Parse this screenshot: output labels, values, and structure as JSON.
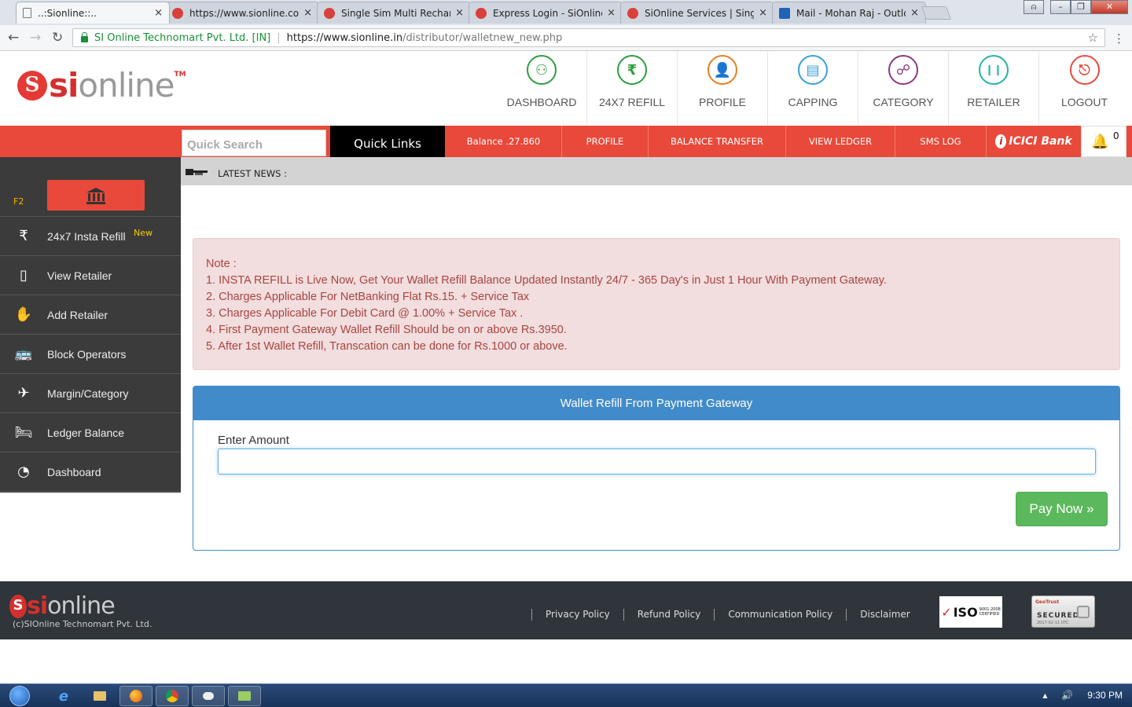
{
  "browser": {
    "tabs": [
      {
        "title": "..:Sionline::..",
        "active": true,
        "favicon": "doc-icon"
      },
      {
        "title": "https://www.sionline.co.in",
        "favicon": "sionline-icon"
      },
      {
        "title": "Single Sim Multi Recharge",
        "favicon": "sionline-icon"
      },
      {
        "title": "Express Login - SiOnline",
        "favicon": "sionline-icon"
      },
      {
        "title": "SiOnline Services | Single",
        "favicon": "sionline-icon"
      },
      {
        "title": "Mail - Mohan Raj - Outlook",
        "favicon": "outlook-icon"
      }
    ],
    "close_glyph": "×",
    "secure_label": "SI Online Technomart Pvt. Ltd. [IN]",
    "url_host": "https://www.sionline.in",
    "url_path": "/distributor/walletnew_new.php"
  },
  "header": {
    "logo": {
      "mark": "S",
      "si": "si",
      "online": "online",
      "tm": "TM"
    },
    "nav": [
      {
        "label": "DASHBOARD",
        "color": "#2e9e3e",
        "glyph": "⚇"
      },
      {
        "label": "24X7 REFILL",
        "color": "#2e9e3e",
        "glyph": "₹"
      },
      {
        "label": "PROFILE",
        "color": "#e67e22",
        "glyph": "👤"
      },
      {
        "label": "CAPPING",
        "color": "#3aa0d8",
        "glyph": "▤"
      },
      {
        "label": "CATEGORY",
        "color": "#8e3a7c",
        "glyph": "☍"
      },
      {
        "label": "RETAILER",
        "color": "#26b5a6",
        "glyph": "❙❙"
      },
      {
        "label": "LOGOUT",
        "color": "#e74c3c",
        "glyph": "⎋"
      }
    ]
  },
  "redbar": {
    "search_placeholder": "Quick Search",
    "quick_links": "Quick Links",
    "links": [
      "Balance .27.860",
      "PROFILE",
      "BALANCE TRANSFER",
      "VIEW LEDGER",
      "SMS LOG"
    ],
    "bank": "ICICI Bank",
    "bank_glyph": "i",
    "notification_count": "0"
  },
  "sidebar": {
    "f2": "F2",
    "items": [
      {
        "label": "24x7 Insta Refill",
        "badge": "New",
        "icon": "rupee-icon",
        "glyph": "₹"
      },
      {
        "label": "View Retailer",
        "icon": "mobile-icon",
        "glyph": "▯"
      },
      {
        "label": "Add Retailer",
        "icon": "hand-money-icon",
        "glyph": "✋"
      },
      {
        "label": "Block Operators",
        "icon": "bus-icon",
        "glyph": "🚌"
      },
      {
        "label": "Margin/Category",
        "icon": "plane-icon",
        "glyph": "✈"
      },
      {
        "label": "Ledger Balance",
        "icon": "bed-icon",
        "glyph": "🛏"
      },
      {
        "label": "Dashboard",
        "icon": "dashboard-icon",
        "glyph": "◔"
      }
    ]
  },
  "news": {
    "label": "LATEST NEWS :"
  },
  "note": {
    "title": "Note :",
    "lines": [
      "1. INSTA REFILL is Live Now, Get Your Wallet Refill Balance Updated Instantly 24/7 - 365 Day's in Just 1 Hour With Payment Gateway.",
      "2. Charges Applicable For NetBanking Flat Rs.15. + Service Tax",
      "3. Charges Applicable For Debit Card @ 1.00% + Service Tax .",
      "4. First Payment Gateway Wallet Refill Should be on or above Rs.3950.",
      "5. After 1st Wallet Refill, Transcation can be done for Rs.1000 or above."
    ]
  },
  "wallet": {
    "title": "Wallet Refill From Payment Gateway",
    "amount_label": "Enter Amount",
    "amount_value": "",
    "pay_button": "Pay Now »"
  },
  "footer": {
    "logo": {
      "mark": "S",
      "si": "si",
      "online": "online"
    },
    "copyright": "(c)SIOnline Technomart Pvt. Ltd.",
    "links": [
      "Privacy Policy",
      "Refund Policy",
      "Communication Policy",
      "Disclaimer"
    ],
    "iso": {
      "text": "ISO",
      "check": "✓",
      "sub1": "9001:2008",
      "sub2": "CERTIFIED"
    },
    "geotrust": {
      "brand": "GeoTrust",
      "label": "SECURED",
      "date": "2017-02-11 UTC"
    }
  },
  "taskbar": {
    "clock": "9:30 PM"
  }
}
